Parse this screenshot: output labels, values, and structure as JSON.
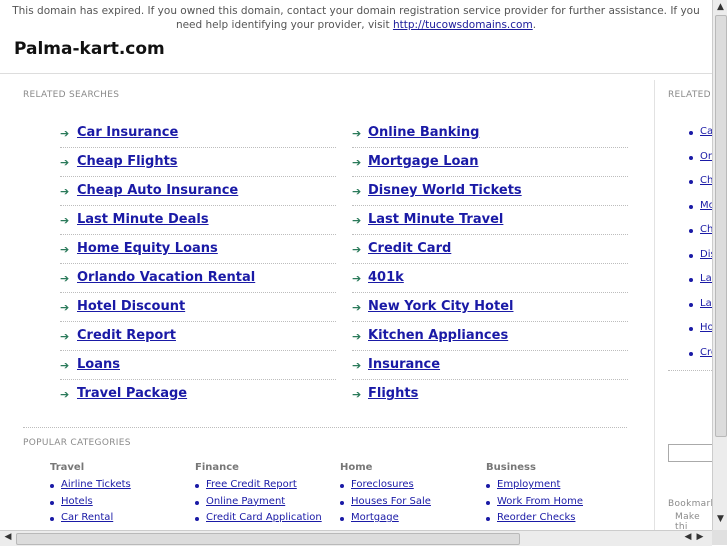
{
  "notice": {
    "text_before": "This domain has expired. If you owned this domain, contact your domain registration service provider for further assistance. If you need help identifying your provider, visit ",
    "link_text": "http://tucowsdomains.com",
    "text_after": "."
  },
  "domain_title": "Palma-kart.com",
  "related": {
    "heading": "RELATED SEARCHES",
    "left": [
      "Car Insurance",
      "Cheap Flights",
      "Cheap Auto Insurance",
      "Last Minute Deals",
      "Home Equity Loans",
      "Orlando Vacation Rental",
      "Hotel Discount",
      "Credit Report",
      "Loans",
      "Travel Package"
    ],
    "right": [
      "Online Banking",
      "Mortgage Loan",
      "Disney World Tickets",
      "Last Minute Travel",
      "Credit Card",
      "401k",
      "New York City Hotel",
      "Kitchen Appliances",
      "Insurance",
      "Flights"
    ]
  },
  "popular": {
    "heading": "POPULAR CATEGORIES",
    "columns": [
      {
        "title": "Travel",
        "items": [
          "Airline Tickets",
          "Hotels",
          "Car Rental"
        ]
      },
      {
        "title": "Finance",
        "items": [
          "Free Credit Report",
          "Online Payment",
          "Credit Card Application"
        ]
      },
      {
        "title": "Home",
        "items": [
          "Foreclosures",
          "Houses For Sale",
          "Mortgage"
        ]
      },
      {
        "title": "Business",
        "items": [
          "Employment",
          "Work From Home",
          "Reorder Checks"
        ]
      }
    ]
  },
  "sidebar": {
    "heading": "RELATED",
    "items": [
      "Ca",
      "On",
      "Ch",
      "Mo",
      "Ch",
      "Dis",
      "Las",
      "Las",
      "Ho",
      "Cre"
    ],
    "bookmark_line1": "Bookmark",
    "bookmark_line2": "Make thi"
  },
  "colors": {
    "link": "#1a1aa6",
    "arrow": "#2a7a5a"
  }
}
